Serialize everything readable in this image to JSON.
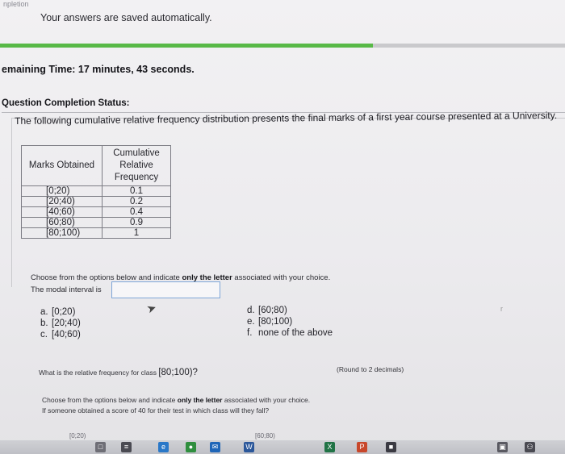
{
  "header": {
    "completion_tab": "npletion",
    "autosave_note": "Your answers are saved automatically.",
    "progress_fraction": 0.66,
    "remaining_time": "emaining Time: 17 minutes, 43 seconds.",
    "question_status": "Question Completion Status:"
  },
  "question": {
    "prompt": "The following cumulative relative frequency distribution presents the final marks of a first year course presented at a University.",
    "table": {
      "headers": {
        "marks": "Marks Obtained",
        "cum_1": "Cumulative",
        "cum_2": "Relative",
        "cum_3": "Frequency"
      },
      "rows": [
        {
          "marks": "[0;20)",
          "cum": "0.1"
        },
        {
          "marks": "[20;40)",
          "cum": "0.2"
        },
        {
          "marks": "[40;60)",
          "cum": "0.4"
        },
        {
          "marks": "[60;80)",
          "cum": "0.9"
        },
        {
          "marks": "[80;100)",
          "cum": "1"
        }
      ]
    },
    "instruction_pre": "Choose from the options below and indicate ",
    "instruction_bold": "only the letter",
    "instruction_post": " associated with your choice.",
    "modal_label": "The modal interval is",
    "modal_answer": "",
    "options": [
      {
        "letter": "a.",
        "text": "[0;20)"
      },
      {
        "letter": "b.",
        "text": "[20;40)"
      },
      {
        "letter": "c.",
        "text": "[40;60)"
      },
      {
        "letter": "d.",
        "text": "[60;80)"
      },
      {
        "letter": "e.",
        "text": "[80;100)"
      },
      {
        "letter": "f.",
        "text": "none of the above"
      }
    ],
    "side_mark": "r"
  },
  "question2": {
    "text": "What is the relative frequency for class ",
    "class_text": "[80;100)?",
    "round_note": "(Round to 2 decimals)"
  },
  "question3": {
    "instruction_pre": "Choose from the options below and indicate ",
    "instruction_bold": "only the letter",
    "instruction_post": " associated with your choice.",
    "score_question": "If someone obtained a score of 40 for their test in which class will they fall?",
    "peek_left": "[0;20)",
    "peek_right": "[60;80)"
  },
  "taskbar": {
    "icons": [
      {
        "name": "file-icon",
        "glyph": "□",
        "color": "#6e6e76"
      },
      {
        "name": "task-view-icon",
        "glyph": "≡",
        "color": "#4a4a52"
      },
      {
        "name": "edge-icon",
        "glyph": "e",
        "color": "#2a78c8"
      },
      {
        "name": "chrome-icon",
        "glyph": "●",
        "color": "#2f8e3e"
      },
      {
        "name": "mail-icon",
        "glyph": "✉",
        "color": "#1f66b8"
      },
      {
        "name": "word-icon",
        "glyph": "W",
        "color": "#2b579a"
      },
      {
        "name": "excel-icon",
        "glyph": "X",
        "color": "#217346"
      },
      {
        "name": "powerpoint-icon",
        "glyph": "P",
        "color": "#c8472b"
      },
      {
        "name": "app-icon",
        "glyph": "■",
        "color": "#3a3a42"
      },
      {
        "name": "store-icon",
        "glyph": "▣",
        "color": "#5a5a62"
      },
      {
        "name": "people-icon",
        "glyph": "⚇",
        "color": "#4a4a52"
      }
    ]
  },
  "colors": {
    "progress": "#58b947",
    "input_border": "#7ea6d8"
  }
}
